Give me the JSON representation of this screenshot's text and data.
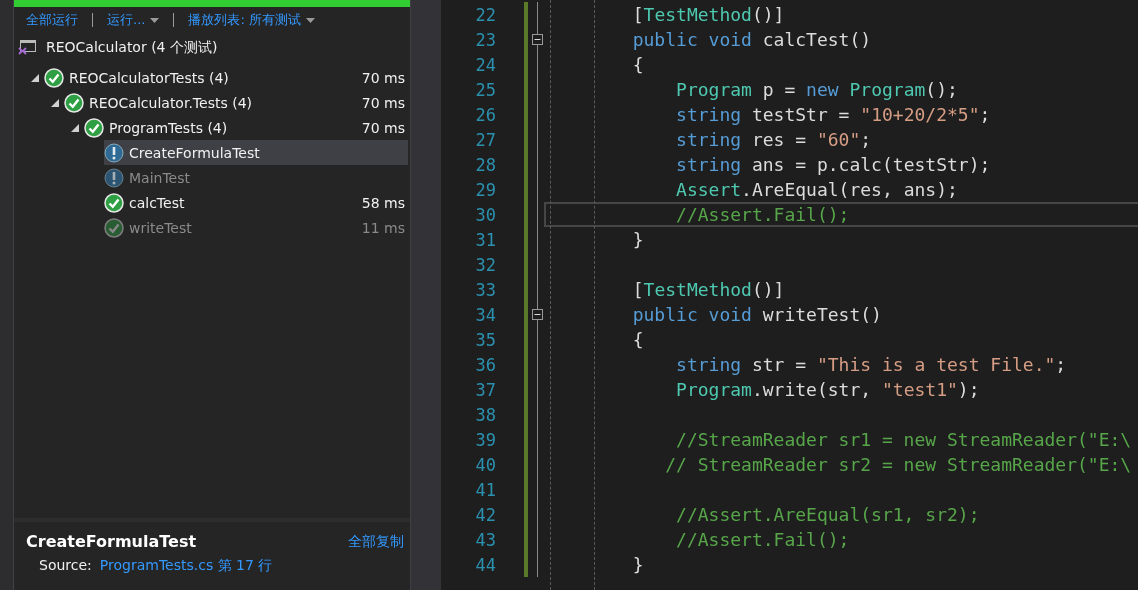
{
  "toolbar": {
    "items": [
      {
        "label": "全部运行",
        "dropdown": false
      },
      {
        "label": "运行...",
        "dropdown": true
      },
      {
        "label": "播放列表: 所有测试",
        "dropdown": true
      }
    ]
  },
  "project": {
    "title": "REOCalculator (4 个测试)"
  },
  "tree": [
    {
      "label": "REOCalculatorTests (4)",
      "kind": "passed",
      "dimmed": false,
      "selected": false,
      "expanded": true,
      "time": "70 ms",
      "children": [
        {
          "label": "REOCalculator.Tests (4)",
          "kind": "passed",
          "dimmed": false,
          "selected": false,
          "expanded": true,
          "time": "70 ms",
          "children": [
            {
              "label": "ProgramTests (4)",
              "kind": "passed",
              "dimmed": false,
              "selected": false,
              "expanded": true,
              "time": "70 ms",
              "children": [
                {
                  "label": "CreateFormulaTest",
                  "kind": "warning",
                  "dimmed": false,
                  "selected": true
                },
                {
                  "label": "MainTest",
                  "kind": "warning",
                  "dimmed": true,
                  "selected": false
                },
                {
                  "label": "calcTest",
                  "kind": "passed",
                  "dimmed": false,
                  "selected": false,
                  "time": "58 ms"
                },
                {
                  "label": "writeTest",
                  "kind": "passed",
                  "dimmed": true,
                  "selected": false,
                  "time": "11 ms"
                }
              ]
            }
          ]
        }
      ]
    }
  ],
  "detail": {
    "title": "CreateFormulaTest",
    "copy_link": "全部复制",
    "source_label": "Source:",
    "source_link": "ProgramTests.cs 第 17 行"
  },
  "code": [
    {
      "number": "22",
      "tokens": [
        {
          "kind": "plain",
          "text": "        ["
        },
        {
          "kind": "type",
          "text": "TestMethod"
        },
        {
          "kind": "plain",
          "text": "()]"
        }
      ]
    },
    {
      "number": "23",
      "fold": true,
      "tokens": [
        {
          "kind": "keyword",
          "text": "        public void "
        },
        {
          "kind": "plain",
          "text": "calcTest()"
        }
      ]
    },
    {
      "number": "24",
      "tokens": [
        {
          "kind": "plain",
          "text": "        {"
        }
      ]
    },
    {
      "number": "25",
      "tokens": [
        {
          "kind": "type",
          "text": "            Program"
        },
        {
          "kind": "plain",
          "text": " p = "
        },
        {
          "kind": "keyword",
          "text": "new "
        },
        {
          "kind": "type",
          "text": "Program"
        },
        {
          "kind": "plain",
          "text": "();"
        }
      ]
    },
    {
      "number": "26",
      "tokens": [
        {
          "kind": "keyword",
          "text": "            string"
        },
        {
          "kind": "plain",
          "text": " testStr = "
        },
        {
          "kind": "string",
          "text": "\"10+20/2*5\""
        },
        {
          "kind": "plain",
          "text": ";"
        }
      ]
    },
    {
      "number": "27",
      "tokens": [
        {
          "kind": "keyword",
          "text": "            string"
        },
        {
          "kind": "plain",
          "text": " res = "
        },
        {
          "kind": "string",
          "text": "\"60\""
        },
        {
          "kind": "plain",
          "text": ";"
        }
      ]
    },
    {
      "number": "28",
      "tokens": [
        {
          "kind": "keyword",
          "text": "            string"
        },
        {
          "kind": "plain",
          "text": " ans = p.calc(testStr);"
        }
      ]
    },
    {
      "number": "29",
      "tokens": [
        {
          "kind": "type",
          "text": "            Assert"
        },
        {
          "kind": "plain",
          "text": ".AreEqual(res, ans);"
        }
      ]
    },
    {
      "number": "30",
      "current": true,
      "tokens": [
        {
          "kind": "comment",
          "text": "            //Assert.Fail();"
        }
      ]
    },
    {
      "number": "31",
      "tokens": [
        {
          "kind": "plain",
          "text": "        }"
        }
      ]
    },
    {
      "number": "32"
    },
    {
      "number": "33",
      "tokens": [
        {
          "kind": "plain",
          "text": "        ["
        },
        {
          "kind": "type",
          "text": "TestMethod"
        },
        {
          "kind": "plain",
          "text": "()]"
        }
      ]
    },
    {
      "number": "34",
      "fold": true,
      "tokens": [
        {
          "kind": "keyword",
          "text": "        public void "
        },
        {
          "kind": "plain",
          "text": "writeTest()"
        }
      ]
    },
    {
      "number": "35",
      "tokens": [
        {
          "kind": "plain",
          "text": "        {"
        }
      ]
    },
    {
      "number": "36",
      "tokens": [
        {
          "kind": "keyword",
          "text": "            string"
        },
        {
          "kind": "plain",
          "text": " str = "
        },
        {
          "kind": "string",
          "text": "\"This is a test File.\""
        },
        {
          "kind": "plain",
          "text": ";"
        }
      ]
    },
    {
      "number": "37",
      "tokens": [
        {
          "kind": "type",
          "text": "            Program"
        },
        {
          "kind": "plain",
          "text": ".write(str, "
        },
        {
          "kind": "string",
          "text": "\"test1\""
        },
        {
          "kind": "plain",
          "text": ");"
        }
      ]
    },
    {
      "number": "38"
    },
    {
      "number": "39",
      "tokens": [
        {
          "kind": "comment",
          "text": "            //StreamReader sr1 = new StreamReader(\"E:\\"
        }
      ]
    },
    {
      "number": "40",
      "tokens": [
        {
          "kind": "comment",
          "text": "           // StreamReader sr2 = new StreamReader(\"E:\\"
        }
      ]
    },
    {
      "number": "41"
    },
    {
      "number": "42",
      "tokens": [
        {
          "kind": "comment",
          "text": "            //Assert.AreEqual(sr1, sr2);"
        }
      ]
    },
    {
      "number": "43",
      "tokens": [
        {
          "kind": "comment",
          "text": "            //Assert.Fail();"
        }
      ]
    },
    {
      "number": "44",
      "tokens": [
        {
          "kind": "plain",
          "text": "        }"
        }
      ]
    }
  ]
}
